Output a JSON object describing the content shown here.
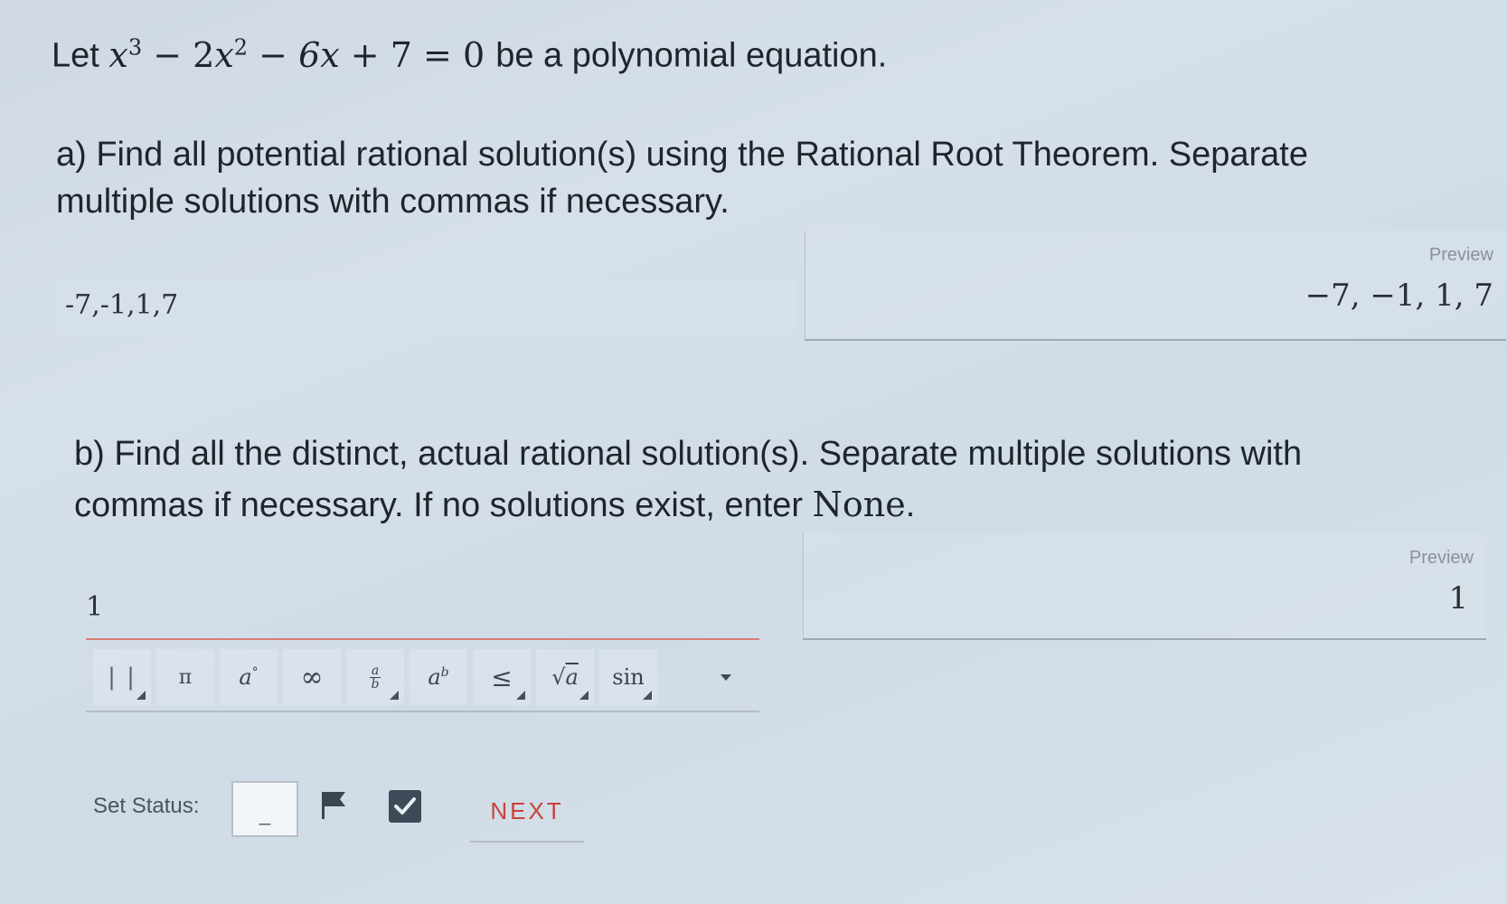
{
  "question": {
    "intro_prefix": "Let",
    "equation": {
      "t1_base": "x",
      "t1_exp": "3",
      "op1": "−",
      "t2_coef": "2",
      "t2_base": "x",
      "t2_exp": "2",
      "op2": "−",
      "t3": "6x",
      "op3": "+",
      "t4": "7",
      "eq": "=",
      "rhs": "0"
    },
    "intro_suffix": "be a polynomial equation."
  },
  "part_a": {
    "prompt_line1": "a) Find all potential rational solution(s) using the Rational Root Theorem. Separate",
    "prompt_line2": "multiple solutions with commas if necessary.",
    "answer_value": "-7,-1,1,7",
    "preview_label": "Preview",
    "preview_value": "−7, −1, 1, 7"
  },
  "part_b": {
    "prompt_line1": "b) Find all the distinct, actual rational solution(s). Separate multiple solutions with",
    "prompt_line2_prefix": "commas if necessary. If no solutions exist, enter ",
    "prompt_line2_none": "None",
    "prompt_line2_suffix": ".",
    "answer_value": "1",
    "preview_label": "Preview",
    "preview_value": "1"
  },
  "toolbar": {
    "buttons": [
      {
        "name": "abs-value",
        "label": "| |",
        "has_menu": true
      },
      {
        "name": "pi",
        "label": "π",
        "has_menu": false
      },
      {
        "name": "degree",
        "label": "a°",
        "has_menu": false
      },
      {
        "name": "infinity",
        "label": "∞",
        "has_menu": false
      },
      {
        "name": "fraction",
        "label": "a/b",
        "has_menu": true
      },
      {
        "name": "exponent",
        "label": "aᵇ",
        "has_menu": false
      },
      {
        "name": "less-equal",
        "label": "≤",
        "has_menu": true
      },
      {
        "name": "sqrt",
        "label": "√a",
        "has_menu": true
      },
      {
        "name": "sin",
        "label": "sin",
        "has_menu": true
      }
    ],
    "dropdown_icon": "caret-down-icon"
  },
  "status": {
    "label": "Set Status:",
    "box_value": "_",
    "flag_icon": "flag-icon",
    "check_icon": "checkbox-checked-icon",
    "next_label": "NEXT"
  },
  "colors": {
    "input_underline": "#d97b76",
    "check_bg": "#3e4a58"
  }
}
